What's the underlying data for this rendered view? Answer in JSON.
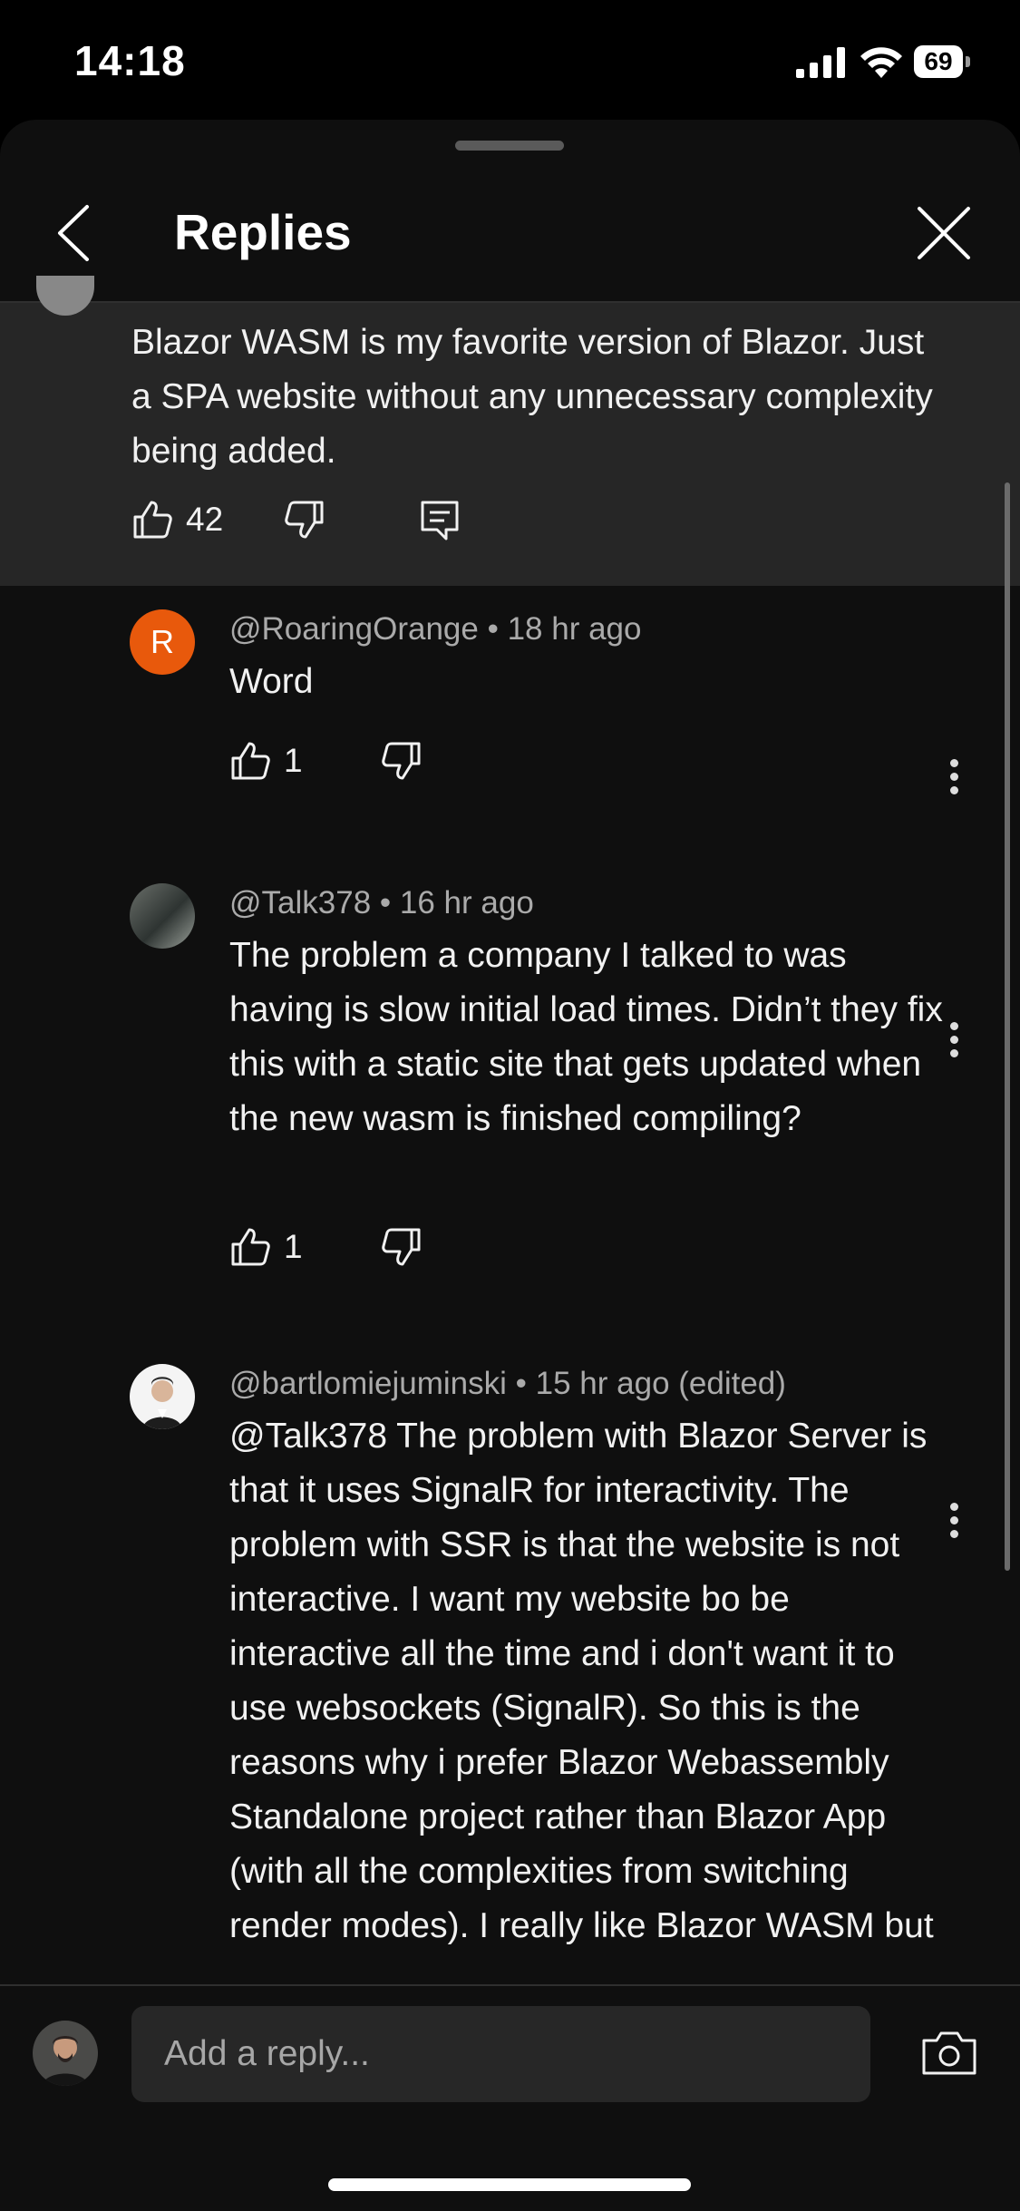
{
  "status_bar": {
    "time": "14:18",
    "battery": "69"
  },
  "header": {
    "title": "Replies"
  },
  "parent_comment": {
    "text": "Blazor WASM is my favorite version of Blazor. Just a SPA website without any unnecessary complexity being added.",
    "likes": "42"
  },
  "replies": [
    {
      "author": "@RoaringOrange",
      "time": "18 hr ago",
      "avatar_letter": "R",
      "text": "Word",
      "likes": "1"
    },
    {
      "author": "@Talk378",
      "time": "16 hr ago",
      "text": "The problem a company I talked to was having is slow initial load times. Didn’t they fix this with a static site that gets updated when the new wasm is finished compiling?",
      "likes": "1"
    },
    {
      "author": "@bartlomiejuminski",
      "time": "15 hr ago (edited)",
      "text": "@Talk378  The problem with Blazor Server is that it uses SignalR for interactivity. The problem with SSR is that the website is not interactive. I want my website bo be interactive all the time and i don't want it to use websockets (SignalR). So this is the reasons why i prefer Blazor Webassembly Standalone project rather than Blazor App (with all the complexities from switching render modes). I really like Blazor WASM but"
    }
  ],
  "separator": "•",
  "reply_box": {
    "placeholder": "Add a reply..."
  },
  "colors": {
    "accent_avatar": "#e8590c",
    "background": "#0f0f0f",
    "highlight": "#262626"
  }
}
